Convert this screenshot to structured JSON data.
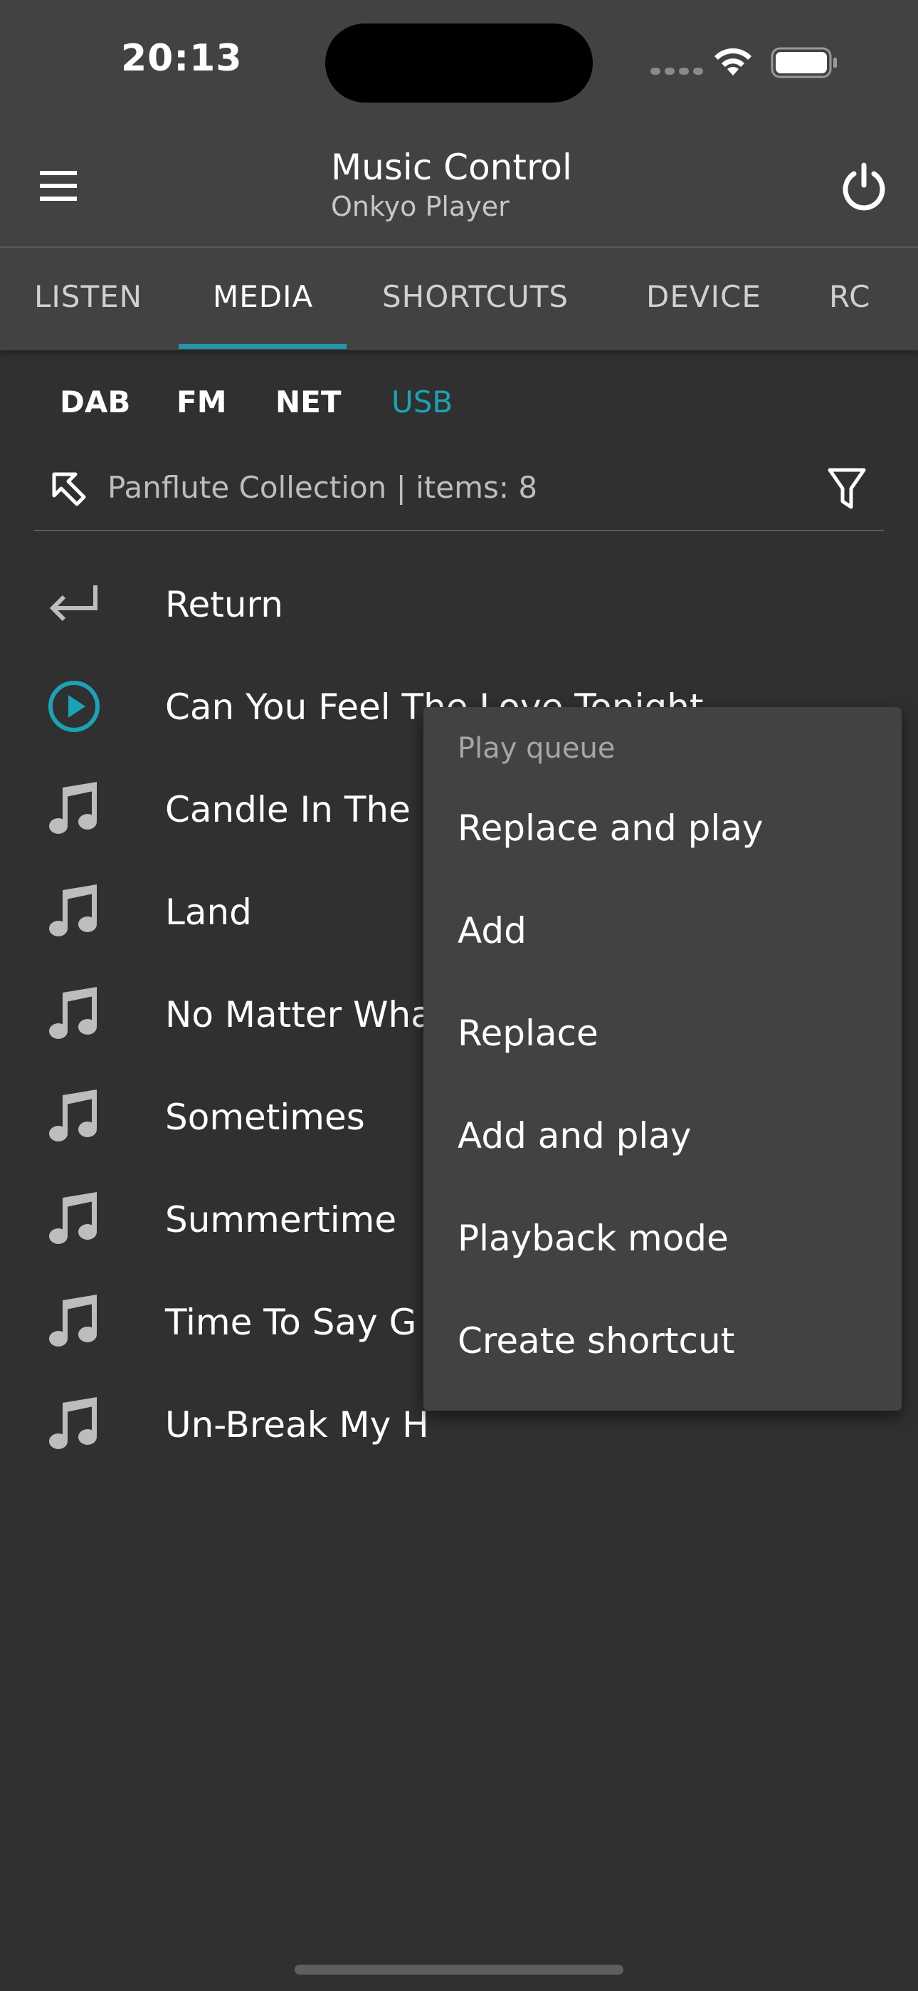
{
  "status_bar": {
    "time": "20:13"
  },
  "app_bar": {
    "title": "Music Control",
    "subtitle": "Onkyo Player"
  },
  "tabs": [
    {
      "label": "LISTEN",
      "active": false
    },
    {
      "label": "MEDIA",
      "active": true
    },
    {
      "label": "SHORTCUTS",
      "active": false
    },
    {
      "label": "DEVICE",
      "active": false
    },
    {
      "label": "RC",
      "active": false
    }
  ],
  "sources": [
    {
      "label": "DAB",
      "active": false
    },
    {
      "label": "FM",
      "active": false
    },
    {
      "label": "NET",
      "active": false
    },
    {
      "label": "USB",
      "active": true
    }
  ],
  "path": {
    "text": "Panflute Collection | items: 8"
  },
  "list": [
    {
      "label": "Return",
      "icon": "return-arrow-icon"
    },
    {
      "label": "Can You Feel The Love Tonight",
      "icon": "play-circle-icon"
    },
    {
      "label": "Candle In The",
      "icon": "music-note-icon"
    },
    {
      "label": "Land",
      "icon": "music-note-icon"
    },
    {
      "label": "No Matter Wha",
      "icon": "music-note-icon"
    },
    {
      "label": "Sometimes",
      "icon": "music-note-icon"
    },
    {
      "label": "Summertime",
      "icon": "music-note-icon"
    },
    {
      "label": "Time To Say G",
      "icon": "music-note-icon"
    },
    {
      "label": "Un-Break My H",
      "icon": "music-note-icon"
    }
  ],
  "context_menu": {
    "header": "Play queue",
    "items": [
      "Replace and play",
      "Add",
      "Replace",
      "Add and play",
      "Playback mode",
      "Create shortcut"
    ]
  },
  "colors": {
    "accent": "#1ba2b6",
    "background": "#303030",
    "bar": "#424242"
  }
}
